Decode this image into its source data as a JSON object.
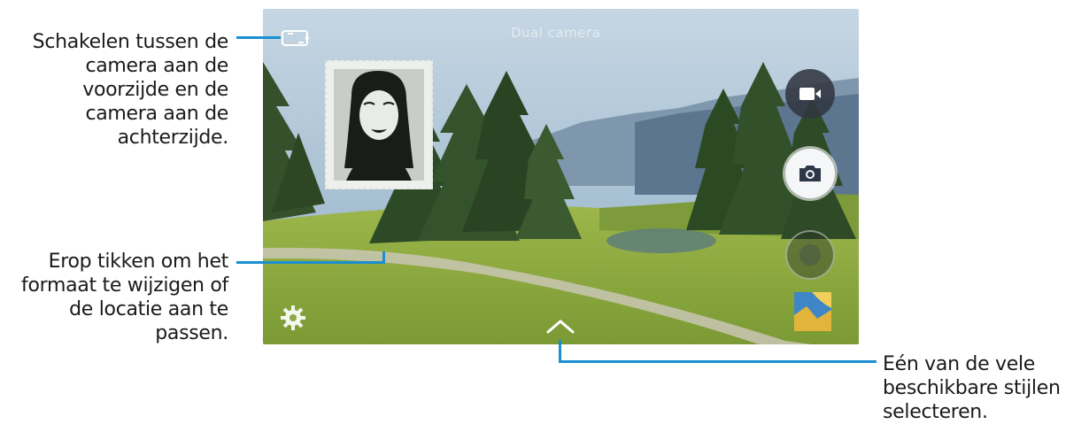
{
  "callouts": {
    "switch_camera": [
      "Schakelen tussen de",
      "camera aan de",
      "voorzijde en de",
      "camera aan de",
      "achterzijde."
    ],
    "resize_move": [
      "Erop tikken om het",
      "formaat te wijzigen of",
      "de locatie aan te",
      "passen."
    ],
    "select_style": [
      "Eén van de vele",
      "beschikbare stijlen",
      "selecteren."
    ]
  },
  "screen": {
    "mode_label": "Dual camera"
  },
  "icons": {
    "switch_camera": "camera-switch-icon",
    "settings": "gear-icon",
    "mode_expander": "chevron-up-icon",
    "record": "video-camera-icon",
    "capture": "camera-icon",
    "mode": "mode-selector-icon",
    "gallery": "gallery-thumbnail"
  },
  "colors": {
    "leader_line": "#1b8fd0",
    "sky": "#a9c4d8",
    "grass": "#8fae42"
  }
}
